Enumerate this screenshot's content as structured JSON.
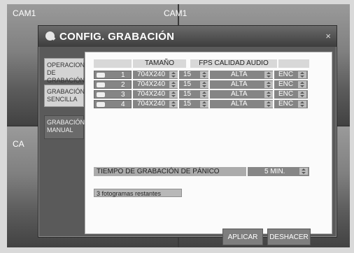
{
  "cameras": [
    {
      "label": "CAM1"
    },
    {
      "label": "CAM1"
    },
    {
      "label": "CA"
    },
    {
      "label": ""
    }
  ],
  "dialog": {
    "title": "CONFIG. GRABACIÓN",
    "close_glyph": "×"
  },
  "sidebar": {
    "items": [
      {
        "label": "OPERACIONES DE GRABACIÓN"
      },
      {
        "label": "GRABACIÓN SENCILLA"
      },
      {
        "label": "GRABACIÓN MANUAL"
      }
    ]
  },
  "table": {
    "headers": {
      "size": "TAMAÑO",
      "fps_quality_audio": "FPS CALIDAD AUDIO"
    },
    "rows": [
      {
        "channel": "1",
        "size": "704X240",
        "fps": "15",
        "quality": "ALTA",
        "audio": "ENC"
      },
      {
        "channel": "2",
        "size": "704X240",
        "fps": "15",
        "quality": "ALTA",
        "audio": "ENC"
      },
      {
        "channel": "3",
        "size": "704X240",
        "fps": "15",
        "quality": "ALTA",
        "audio": "ENC"
      },
      {
        "channel": "4",
        "size": "704X240",
        "fps": "15",
        "quality": "ALTA",
        "audio": "ENC"
      }
    ]
  },
  "panic": {
    "label": "TIEMPO DE GRABACIÓN DE PÁNICO",
    "value": "5 MIN."
  },
  "frames_remaining": "3 fotogramas restantes",
  "buttons": {
    "apply": "APLICAR",
    "undo": "DESHACER"
  }
}
